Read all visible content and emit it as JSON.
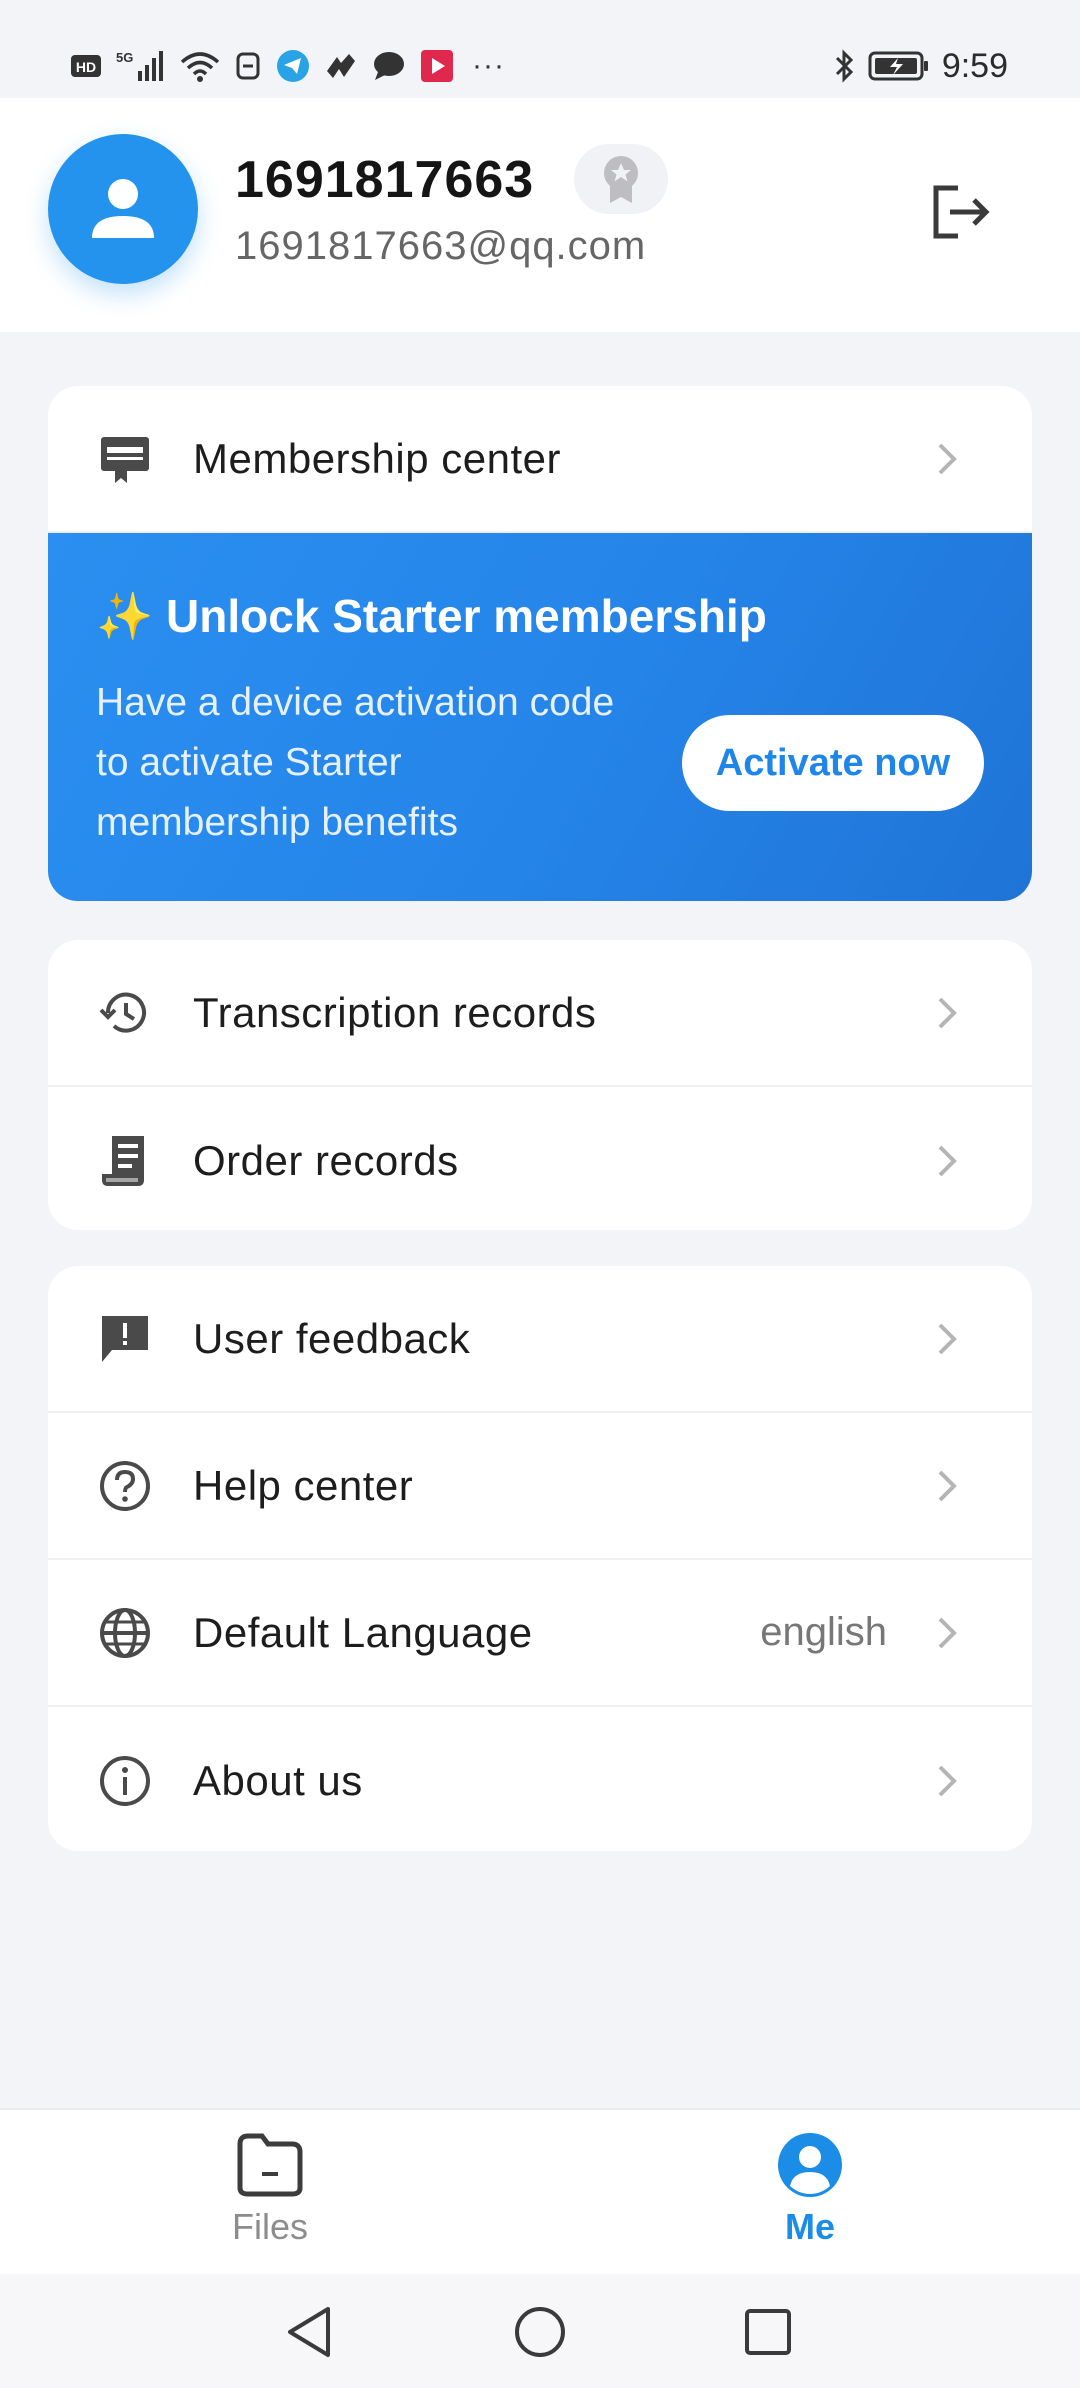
{
  "status_bar": {
    "time": "9:59",
    "left_icons": [
      "hd-icon",
      "5g-signal-icon",
      "wifi-icon",
      "app-icon",
      "telegram-icon",
      "app-icon",
      "chat-icon",
      "video-app-icon"
    ],
    "more": "···",
    "right_icons": [
      "bluetooth-icon",
      "battery-icon"
    ]
  },
  "header": {
    "user_name": "1691817663",
    "email": "1691817663@qq.com"
  },
  "membership": {
    "label": "Membership center",
    "promo_title": "✨ Unlock Starter membership",
    "promo_text": "Have a device activation code to activate Starter membership benefits",
    "activate_label": "Activate now"
  },
  "records": {
    "items": [
      {
        "label": "Transcription records",
        "icon": "history-icon"
      },
      {
        "label": "Order records",
        "icon": "receipt-icon"
      }
    ]
  },
  "settings": {
    "items": [
      {
        "label": "User feedback",
        "icon": "feedback-icon"
      },
      {
        "label": "Help center",
        "icon": "help-icon"
      },
      {
        "label": "Default Language",
        "icon": "globe-icon",
        "value": "english"
      },
      {
        "label": "About us",
        "icon": "info-icon"
      }
    ]
  },
  "bottom_nav": {
    "files_label": "Files",
    "me_label": "Me"
  },
  "colors": {
    "accent": "#1b8de6",
    "avatar": "#2493ee",
    "promo": "#2584e8",
    "background": "#f3f4f8"
  }
}
